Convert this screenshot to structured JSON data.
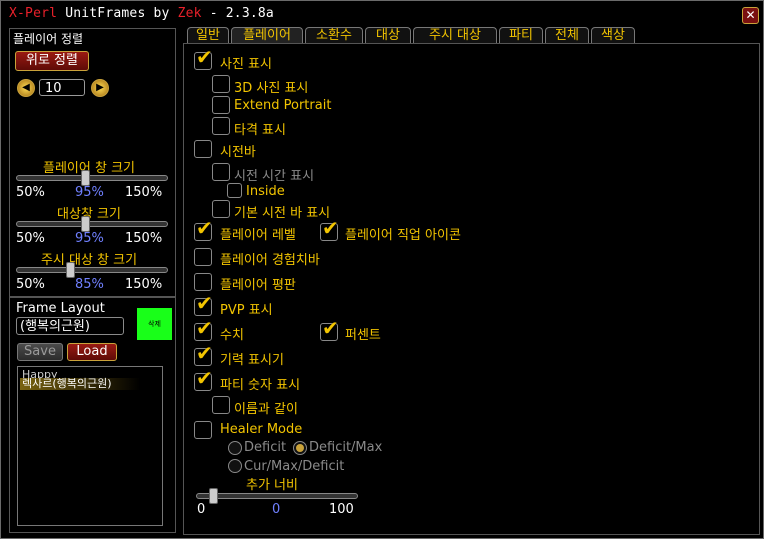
{
  "title": {
    "xperl": "X-Perl",
    "mid": "UnitFrames by",
    "zek": "Zek",
    "version": "- 2.3.8a"
  },
  "left": {
    "sort_label": "플레이어 정렬",
    "sort_button": "위로 정렬",
    "spin_value": "10",
    "sliders": [
      {
        "label": "플레이어 창 크기",
        "min": "50%",
        "value": "95%",
        "max": "150%",
        "fraction": 0.45
      },
      {
        "label": "대상창 크기",
        "min": "50%",
        "value": "95%",
        "max": "150%",
        "fraction": 0.45
      },
      {
        "label": "주시 대상 창 크기",
        "min": "50%",
        "value": "85%",
        "max": "150%",
        "fraction": 0.35
      }
    ],
    "frame_layout": {
      "title": "Frame Layout",
      "input_value": "(행복의근원)",
      "color_label": "삭제",
      "save": "Save",
      "load": "Load",
      "list_head": "Happy",
      "list_item": "렉사르(행복의근원)"
    }
  },
  "tabs": [
    "일반",
    "플레이어",
    "소환수",
    "대상",
    "주시 대상",
    "파티",
    "전체",
    "색상"
  ],
  "options": {
    "portrait": "사진 표시",
    "portrait_3d": "3D 사진 표시",
    "extend_portrait": "Extend Portrait",
    "hit_indicator": "타격 표시",
    "castbar": "시전바",
    "cast_time": "시전 시간 표시",
    "inside": "Inside",
    "default_castbar": "기본 시전 바 표시",
    "player_level": "플레이어 레벨",
    "class_icon": "플레이어 직업 아이콘",
    "xp_bar": "플레이어 경험치바",
    "reputation": "플레이어 평판",
    "pvp": "PVP 표시",
    "values": "수치",
    "percent": "퍼센트",
    "energy_ticker": "기력 표시기",
    "party_number": "파티 숫자 표시",
    "with_name": "이름과 같이",
    "healer_mode": "Healer Mode",
    "deficit": "Deficit",
    "deficit_max": "Deficit/Max",
    "cur_max_deficit": "Cur/Max/Deficit",
    "extra_width": {
      "label": "추가 너비",
      "min": "0",
      "value": "0",
      "max": "100",
      "fraction": 0.1
    }
  }
}
